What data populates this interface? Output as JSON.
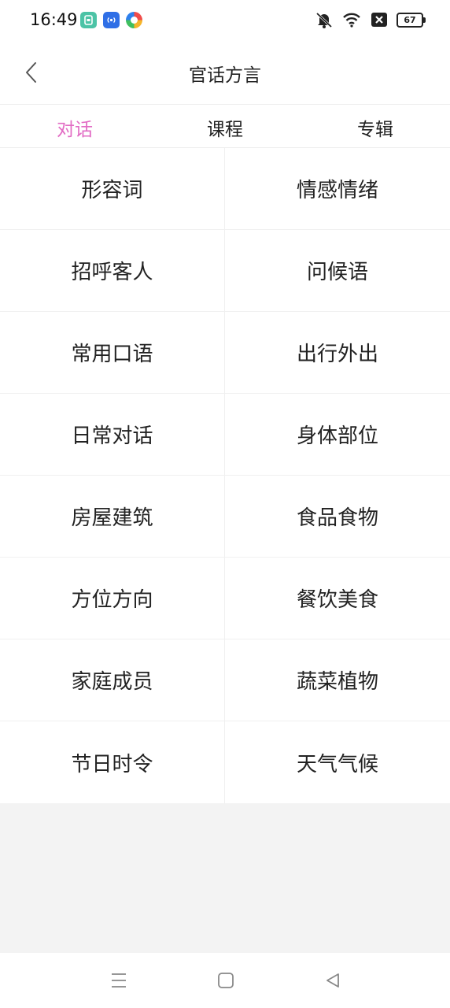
{
  "status_bar": {
    "time": "16:49",
    "battery_level": "67",
    "icons": [
      "notification-app-icon",
      "nfc-app-icon",
      "browser-app-icon",
      "mute-icon",
      "wifi-icon",
      "sim-off-icon",
      "battery-icon"
    ]
  },
  "header": {
    "title": "官话方言"
  },
  "tabs": [
    {
      "label": "对话",
      "active": true
    },
    {
      "label": "课程",
      "active": false
    },
    {
      "label": "专辑",
      "active": false
    }
  ],
  "categories": [
    "形容词",
    "情感情绪",
    "招呼客人",
    "问候语",
    "常用口语",
    "出行外出",
    "日常对话",
    "身体部位",
    "房屋建筑",
    "食品食物",
    "方位方向",
    "餐饮美食",
    "家庭成员",
    "蔬菜植物",
    "节日时令",
    "天气气候"
  ],
  "colors": {
    "accent": "#e26cc4",
    "background": "#f3f3f3",
    "surface": "#ffffff"
  }
}
